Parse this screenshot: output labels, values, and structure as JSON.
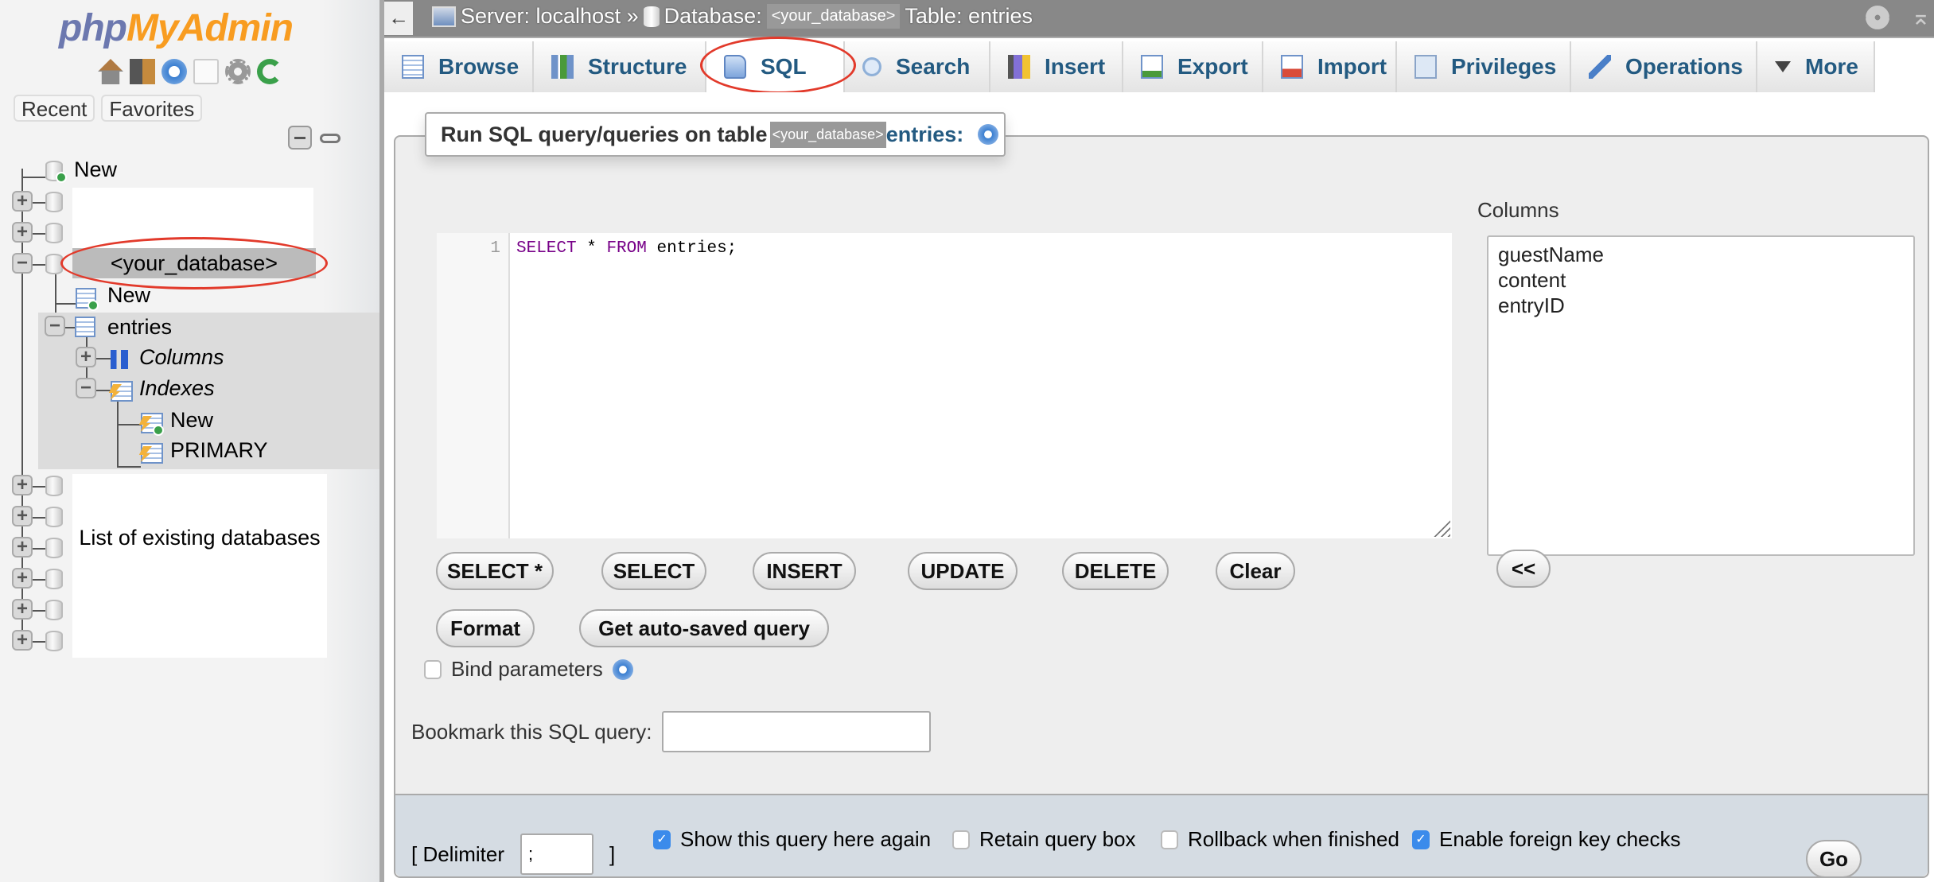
{
  "sidebar": {
    "logo": {
      "php": "php",
      "my_admin": "MyAdmin"
    },
    "nav_icons": [
      "home-icon",
      "logout-icon",
      "help-icon",
      "docs-icon",
      "settings-icon",
      "reload-icon"
    ],
    "recent_label": "Recent",
    "favorites_label": "Favorites",
    "tree": {
      "new_db_label": "New",
      "selected_db": "<your_database>",
      "new_table_label": "New",
      "table_name": "entries",
      "columns_label": "Columns",
      "indexes_label": "Indexes",
      "new_index_label": "New",
      "primary_index_label": "PRIMARY"
    },
    "annotation": "List of existing databases"
  },
  "topbar": {
    "back_symbol": "←",
    "server_label": "Server: localhost »",
    "database_label": "Database:",
    "database_name": "<your_database>",
    "table_label": "Table: entries"
  },
  "tabs": [
    {
      "label": "Browse",
      "icon": "browse-icon"
    },
    {
      "label": "Structure",
      "icon": "structure-icon"
    },
    {
      "label": "SQL",
      "icon": "sql-icon",
      "active": true
    },
    {
      "label": "Search",
      "icon": "search-icon"
    },
    {
      "label": "Insert",
      "icon": "insert-icon"
    },
    {
      "label": "Export",
      "icon": "export-icon"
    },
    {
      "label": "Import",
      "icon": "import-icon"
    },
    {
      "label": "Privileges",
      "icon": "privileges-icon"
    },
    {
      "label": "Operations",
      "icon": "operations-icon"
    },
    {
      "label": "More",
      "icon": "more-triangle-icon"
    }
  ],
  "query": {
    "legend_prefix": "Run SQL query/queries on table",
    "legend_db": "<your_database>",
    "legend_table": "entries:",
    "line_number": "1",
    "code": {
      "kw1": "SELECT",
      "mid": " * ",
      "kw2": "FROM",
      "rest": " entries;"
    },
    "columns_title": "Columns",
    "columns": [
      "guestName",
      "content",
      "entryID"
    ],
    "insert_col_button": "<<",
    "buttons": [
      "SELECT *",
      "SELECT",
      "INSERT",
      "UPDATE",
      "DELETE",
      "Clear"
    ],
    "format_button": "Format",
    "autosave_button": "Get auto-saved query",
    "bind_params_label": "Bind parameters",
    "bind_params_checked": false,
    "bookmark_label": "Bookmark this SQL query:",
    "bookmark_value": ""
  },
  "bottom": {
    "delimiter_open": "[ Delimiter",
    "delimiter_value": ";",
    "delimiter_close": "]",
    "options": [
      {
        "label": "Show this query here again",
        "checked": true
      },
      {
        "label": "Retain query box",
        "checked": false
      },
      {
        "label": "Rollback when finished",
        "checked": false
      },
      {
        "label": "Enable foreign key checks",
        "checked": true
      }
    ],
    "go_button": "Go"
  },
  "colors": {
    "tab_text": "#235a81",
    "annotation_red": "#e23a2b",
    "logo_php": "#6c78af",
    "logo_myadmin": "#f89c20",
    "sql_keyword": "#770088"
  }
}
